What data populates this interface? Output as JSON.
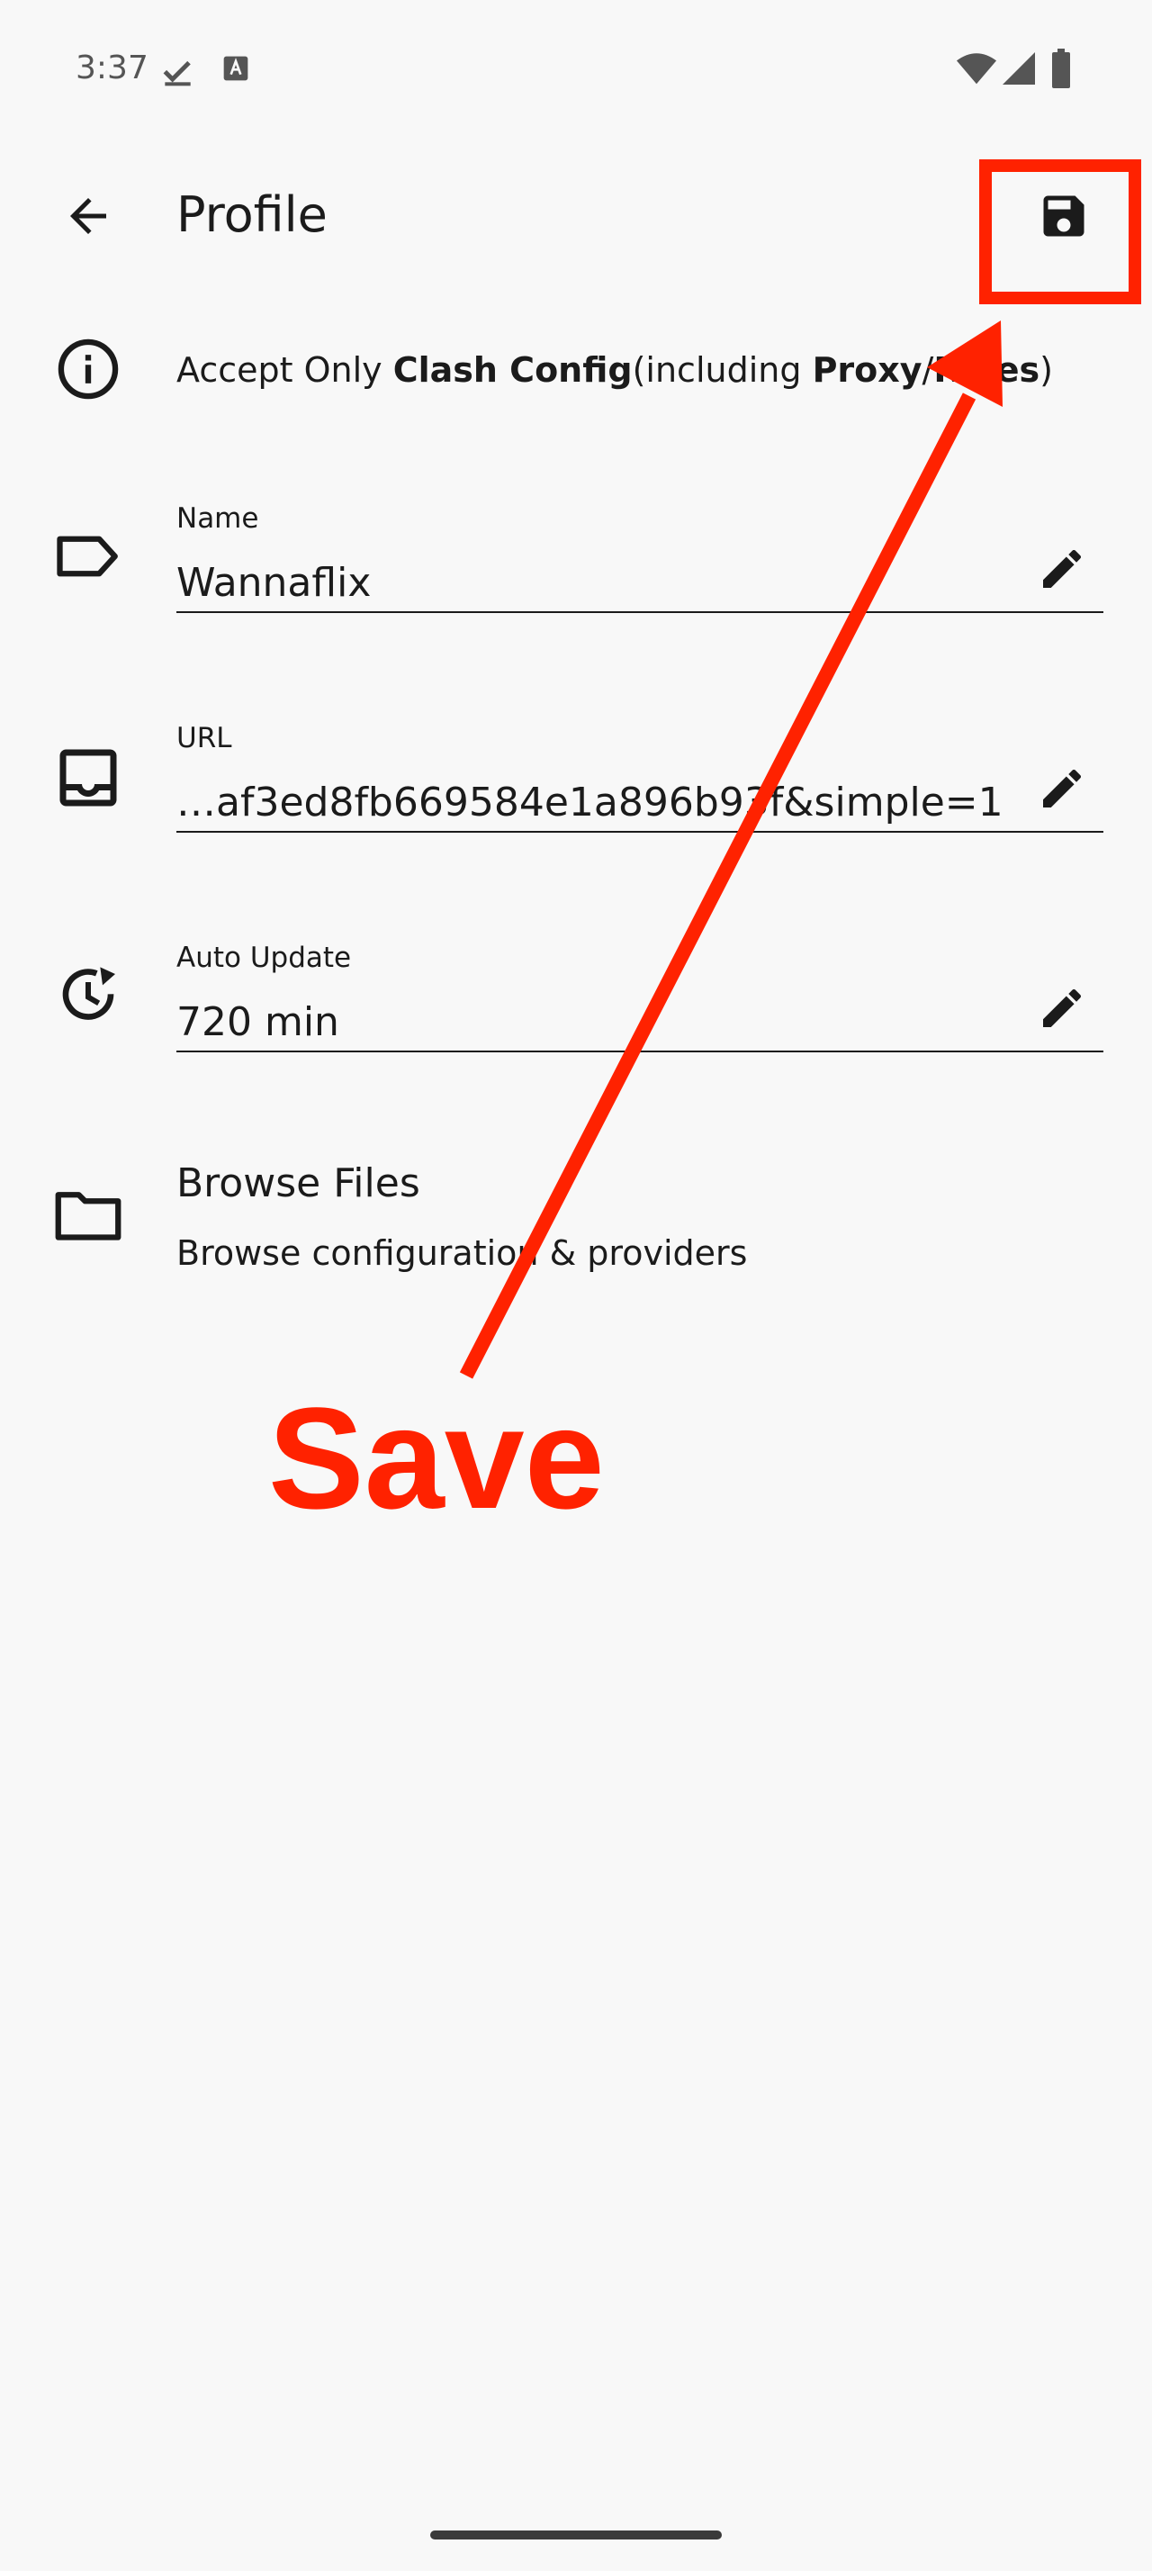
{
  "status_bar": {
    "time": "3:37"
  },
  "app_bar": {
    "title": "Profile"
  },
  "info": {
    "prefix": "Accept Only ",
    "bold1": "Clash Config",
    "middle": "(including ",
    "bold2": "Proxy",
    "sep": "/",
    "bold3": "Rules",
    "suffix": ")"
  },
  "fields": {
    "name": {
      "label": "Name",
      "value": "Wannaflix"
    },
    "url": {
      "label": "URL",
      "value": "…af3ed8fb669584e1a896b93f&simple=1"
    },
    "auto_update": {
      "label": "Auto Update",
      "value": "720 min"
    }
  },
  "browse": {
    "title": "Browse Files",
    "subtitle": "Browse configuration & providers"
  },
  "annotation": {
    "text": "Save",
    "color": "#ff2200"
  },
  "icons": {
    "back": "arrow-back-icon",
    "save": "save-icon",
    "info": "info-icon",
    "name": "label-icon",
    "url": "inbox-icon",
    "auto_update": "update-icon",
    "edit": "edit-icon",
    "browse": "folder-icon"
  }
}
